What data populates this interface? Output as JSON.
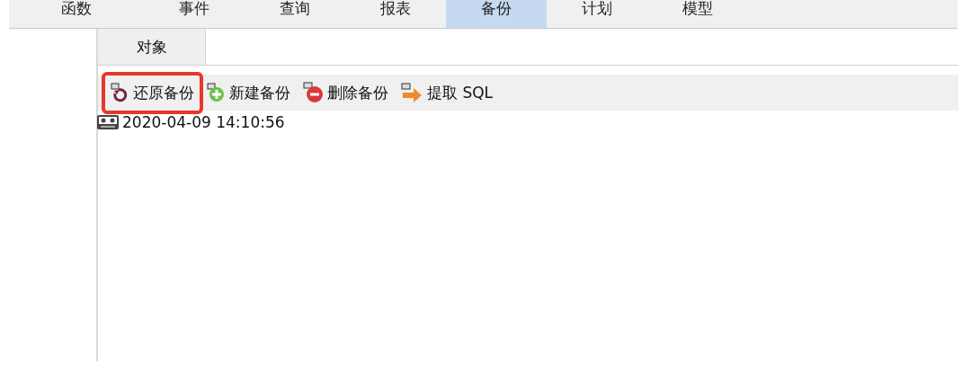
{
  "tabs": [
    {
      "label": "函数",
      "selected": false
    },
    {
      "label": "事件",
      "selected": false
    },
    {
      "label": "查询",
      "selected": false
    },
    {
      "label": "报表",
      "selected": false
    },
    {
      "label": "备份",
      "selected": true
    },
    {
      "label": "计划",
      "selected": false
    },
    {
      "label": "模型",
      "selected": false
    }
  ],
  "object_tab": {
    "label": "对象",
    "selected": true
  },
  "toolbar": [
    {
      "kind": "restore",
      "label": "还原备份",
      "highlighted": true
    },
    {
      "kind": "new",
      "label": "新建备份",
      "highlighted": false
    },
    {
      "kind": "delete",
      "label": "删除备份",
      "highlighted": false
    },
    {
      "kind": "extract",
      "label": "提取 SQL",
      "highlighted": false
    }
  ],
  "backups": [
    {
      "label": "2020-04-09 14:10:56"
    }
  ]
}
